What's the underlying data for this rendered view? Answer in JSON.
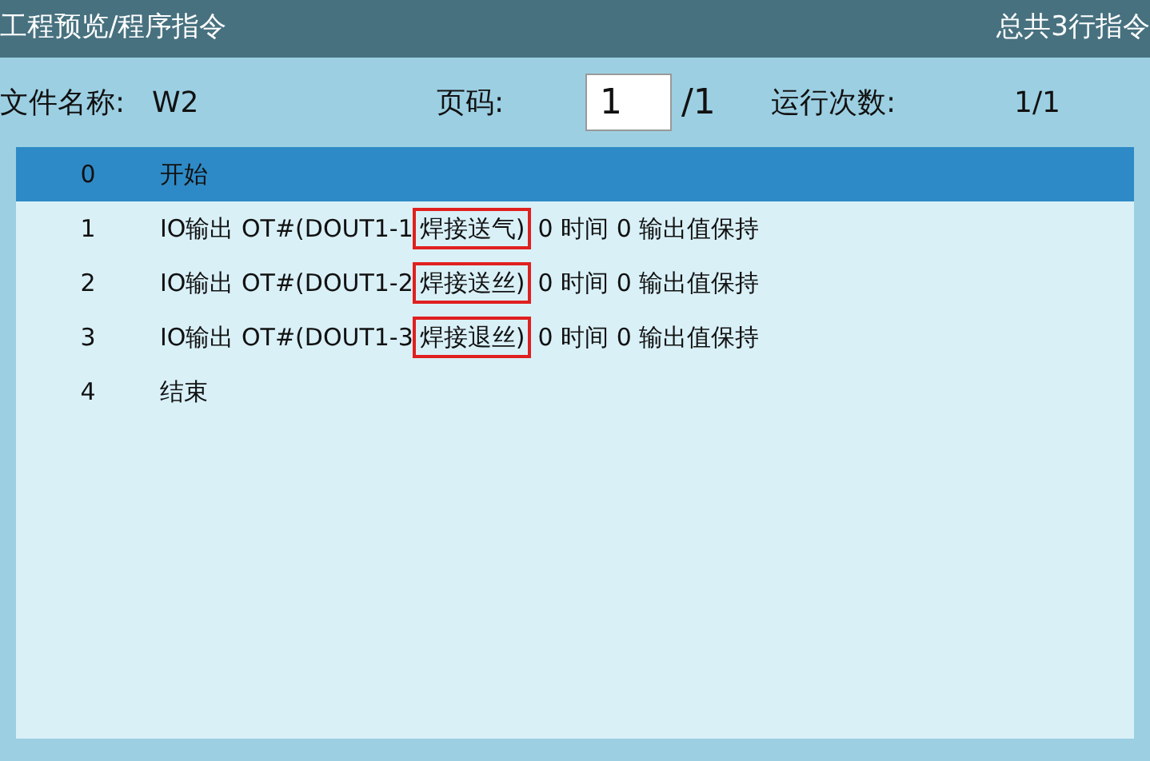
{
  "header": {
    "title": "工程预览/程序指令",
    "summary": "总共3行指令"
  },
  "info": {
    "file_label": "文件名称:",
    "file_name": "W2",
    "page_label": "页码:",
    "page_value": "1",
    "page_total": "/1",
    "runs_label": "运行次数:",
    "runs_value": "1/1"
  },
  "rows": [
    {
      "index": "0",
      "text": "开始",
      "selected": true
    },
    {
      "index": "1",
      "text": "IO输出 OT#(DOUT1-1",
      "marked": "焊接送气)",
      "after": "0 时间 0 输出值保持",
      "selected": false
    },
    {
      "index": "2",
      "text": "IO输出 OT#(DOUT1-2",
      "marked": "焊接送丝)",
      "after": "0 时间 0 输出值保持",
      "selected": false
    },
    {
      "index": "3",
      "text": "IO输出 OT#(DOUT1-3",
      "marked": "焊接退丝)",
      "after": "0 时间 0 输出值保持",
      "selected": false
    },
    {
      "index": "4",
      "text": "结束",
      "selected": false
    }
  ]
}
